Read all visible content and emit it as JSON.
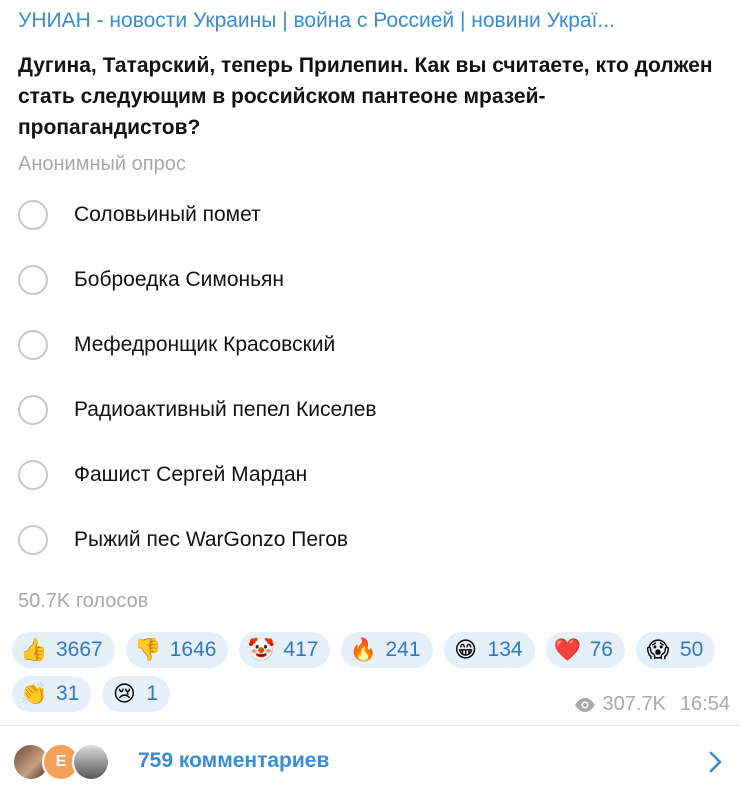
{
  "channel": {
    "title": "УНИАН - новости Украины | война с Россией | новини Украї..."
  },
  "poll": {
    "question": "Дугина, Татарский, теперь Прилепин. Как вы считаете, кто должен стать следующим в российском пантеоне мразей-пропагандистов?",
    "type_label": "Анонимный опрос",
    "options": [
      {
        "label": "Соловьиный помет"
      },
      {
        "label": "Боброедка Симоньян"
      },
      {
        "label": "Мефедронщик Красовский"
      },
      {
        "label": "Радиоактивный пепел Киселев"
      },
      {
        "label": "Фашист Сергей Мардан"
      },
      {
        "label": "Рыжий пес WarGonzo Пегов"
      }
    ],
    "votes_label": "50.7K голосов"
  },
  "reactions": [
    {
      "emoji": "👍",
      "icon": "thumbs-up-icon",
      "count": "3667"
    },
    {
      "emoji": "👎",
      "icon": "thumbs-down-icon",
      "count": "1646"
    },
    {
      "emoji": "🤡",
      "icon": "clown-icon",
      "count": "417"
    },
    {
      "emoji": "🔥",
      "icon": "fire-icon",
      "count": "241"
    },
    {
      "emoji": "😁",
      "icon": "grin-icon",
      "count": "134"
    },
    {
      "emoji": "❤️",
      "icon": "heart-icon",
      "count": "76"
    },
    {
      "emoji": "😱",
      "icon": "scream-icon",
      "count": "50"
    },
    {
      "emoji": "👏",
      "icon": "clap-icon",
      "count": "31"
    },
    {
      "emoji": "😢",
      "icon": "cry-icon",
      "count": "1"
    }
  ],
  "meta": {
    "views": "307.7K",
    "time": "16:54"
  },
  "comments": {
    "label": "759 комментариев",
    "avatar_letter": "E"
  },
  "colors": {
    "accent": "#3b8bd0",
    "reaction_bg": "#e6f0fa",
    "muted": "#a8a8a8"
  }
}
